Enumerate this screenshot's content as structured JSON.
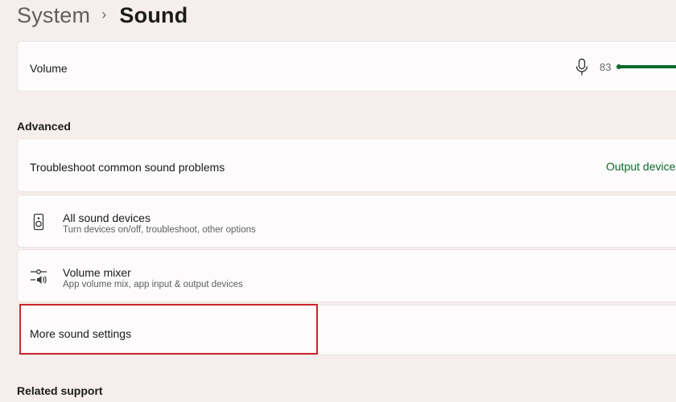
{
  "breadcrumb": {
    "parent": "System",
    "separator": "›",
    "current": "Sound"
  },
  "volume": {
    "label": "Volume",
    "icon": "microphone-icon",
    "value": "83",
    "level_percent": 83,
    "accent_color": "#0a6b2c"
  },
  "advanced": {
    "heading": "Advanced",
    "troubleshoot": {
      "label": "Troubleshoot common sound problems",
      "link": "Output devices"
    },
    "all_sound_devices": {
      "icon": "speaker-icon",
      "title": "All sound devices",
      "subtitle": "Turn devices on/off, troubleshoot, other options"
    },
    "volume_mixer": {
      "icon": "volume-mixer-icon",
      "title": "Volume mixer",
      "subtitle": "App volume mix, app input & output devices"
    },
    "more_sound_settings": {
      "label": "More sound settings",
      "highlight_color": "#c8262c"
    }
  },
  "related_support": {
    "heading": "Related support"
  }
}
